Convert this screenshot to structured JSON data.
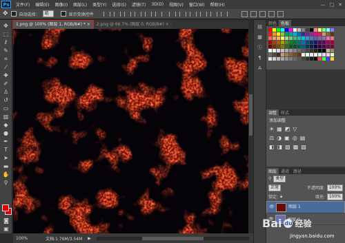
{
  "app": {
    "logo_text": "Ps"
  },
  "menubar": {
    "items": [
      "文件(F)",
      "编辑(E)",
      "图像(I)",
      "图层(L)",
      "类型(Y)",
      "选择(S)",
      "滤镜(T)",
      "3D(D)",
      "视图(V)",
      "窗口(W)",
      "帮助(H)"
    ],
    "window_controls": [
      "—",
      "□",
      "✕"
    ]
  },
  "options": {
    "auto_select_label": "自动选择：",
    "auto_select_value": "组",
    "show_transform_label": "显示变换控件"
  },
  "tabs": [
    {
      "label": "1.png @ 100% (图层 1, RGB/8#) *",
      "close": "×"
    },
    {
      "label": "2.png @ 66.7% (图层 0, RGB/8#)",
      "close": "×"
    }
  ],
  "tools": [
    "move",
    "marquee",
    "lasso",
    "quick-select",
    "crop",
    "eyedropper",
    "spot-heal",
    "brush",
    "clone-stamp",
    "history-brush",
    "eraser",
    "gradient",
    "blur",
    "dodge",
    "pen",
    "type",
    "path-select",
    "shape",
    "hand",
    "zoom"
  ],
  "colors": {
    "foreground": "#e00000",
    "background": "#e00000",
    "accent": "#e02020"
  },
  "status": {
    "zoom": "100%",
    "doc_label": "文档:1.76M/3.54M"
  },
  "panels": {
    "color_tabs": [
      "颜色",
      "色板"
    ],
    "swatch_colors": [
      "#ff0000",
      "#ffff00",
      "#00ff00",
      "#00ffff",
      "#0000ff",
      "#ff00ff",
      "#ffffff",
      "#c0c0c0",
      "#808080",
      "#404040",
      "#000000",
      "#ff8080",
      "#ffff80",
      "#80ff80",
      "#80ffff",
      "#8080ff",
      "#ed1c24",
      "#f7941d",
      "#fff200",
      "#8dc63f",
      "#00a651",
      "#00a99d",
      "#00aeef",
      "#0072bc",
      "#2e3192",
      "#662d91",
      "#92278f",
      "#ec008c",
      "#ed145b",
      "#c69c6d",
      "#8c6239",
      "#603913",
      "#f26c4f",
      "#f69679",
      "#fbaf5d",
      "#fff568",
      "#a3d39c",
      "#7cc576",
      "#3cb878",
      "#1cbbb4",
      "#00bff3",
      "#448ccb",
      "#5674b9",
      "#605ca8",
      "#855fa8",
      "#a864a8",
      "#f06eaa",
      "#f26d7d",
      "#9e0b0f",
      "#a0410d",
      "#a36209",
      "#aba000",
      "#598527",
      "#197b30",
      "#007236",
      "#00746b",
      "#0076a3",
      "#004b80",
      "#003471",
      "#1b1464",
      "#440e62",
      "#630460",
      "#9e005d",
      "#9e0039",
      "#790000",
      "#7b2e00",
      "#7d4900",
      "#827b00",
      "#406618",
      "#005e20",
      "#005826",
      "#005952",
      "#005b7f",
      "#003663",
      "#002157",
      "#0d004c",
      "#32004b",
      "#4b0049",
      "#7b0046",
      "#7a0026",
      "#ffffff",
      "#ebebeb",
      "#d7d7d7",
      "#c2c2c2",
      "#adadad",
      "#999999",
      "#858585",
      "#707070",
      "#5c5c5c",
      "#474747",
      "#333333",
      "#1f1f1f",
      "#0a0a0a",
      "#000000",
      "#c7b299",
      "#998675",
      "#736357",
      "#534741",
      "#37302a",
      "#c69c6d",
      "#a67c52",
      "#8c6239",
      "#754c24",
      "#603913",
      "#ffe6e6",
      "#e6ffe6",
      "#e6e6ff",
      "#fff0cc",
      "#ccf0ff",
      "#f0ccff",
      "#ffccdd",
      "#ddffcc",
      "#e5e5e5",
      "#d0d0d0",
      "#bcbcbc",
      "#a8a8a8",
      "#939393",
      "#7f7f7f",
      "#6b6b6b",
      "#565656",
      "#424242",
      "#2e2e2e",
      "#191919",
      "#050505",
      "#ff4040",
      "#40ff40",
      "#4040ff",
      "#ffd040"
    ],
    "adjust_tabs": [
      "调整",
      "样式"
    ],
    "adjust_title": "添加调整",
    "adjust_row1": [
      "☀",
      "▦",
      "◩",
      "▽"
    ],
    "adjust_row2": [
      "⚖",
      "◑",
      "▣",
      "◎",
      "▤"
    ],
    "adjust_row3": [
      "◧",
      "◨",
      "▨",
      "▩",
      "▧"
    ],
    "layer_tabs": [
      "图层",
      "通道",
      "路径"
    ],
    "kind_label": "类型",
    "blend_mode": "正常",
    "opacity_label": "不透明度:",
    "opacity_value": "100%",
    "lock_label": "锁定:",
    "fill_label": "填充:",
    "fill_value": "100%",
    "layers": [
      {
        "name": "图层 1",
        "selected": true,
        "thumb_color": "#6b0a0a"
      },
      {
        "name": "图层 0",
        "selected": false,
        "thumb_color": "#6a6fb0"
      }
    ]
  },
  "watermark": {
    "brand": "Bai",
    "brand2": "经验",
    "paw": "du",
    "url": "jingyan.baidu.com"
  }
}
